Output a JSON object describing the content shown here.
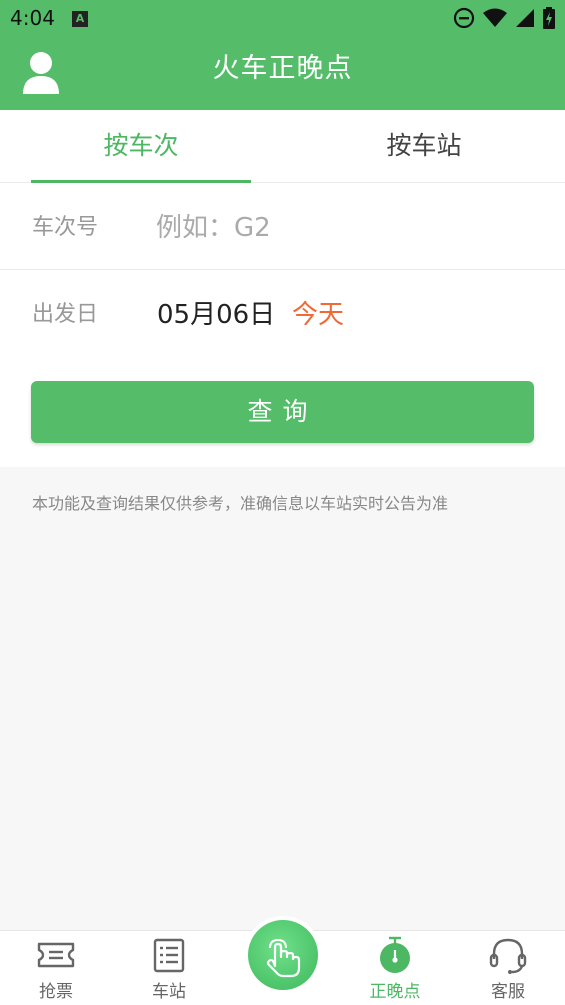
{
  "status_bar": {
    "time": "4:04",
    "notification_icon": "A"
  },
  "header": {
    "title": "火车正晚点",
    "avatar_icon": "user-icon"
  },
  "tabs": [
    {
      "label": "按车次",
      "active": true
    },
    {
      "label": "按车站",
      "active": false
    }
  ],
  "form": {
    "train_label": "车次号",
    "train_placeholder": "例如：G2",
    "date_label": "出发日",
    "date_value": "05月06日",
    "date_hint": "今天",
    "query_label": "查询"
  },
  "notice": "本功能及查询结果仅供参考，准确信息以车站实时公告为准",
  "bottom_nav": [
    {
      "label": "抢票",
      "icon": "ticket-icon"
    },
    {
      "label": "车站",
      "icon": "list-icon"
    },
    {
      "label": "",
      "icon": "tap-hand-icon"
    },
    {
      "label": "正晚点",
      "icon": "timer-icon",
      "active": true
    },
    {
      "label": "客服",
      "icon": "headset-icon"
    }
  ],
  "colors": {
    "primary": "#55bd6a",
    "accent": "#f06a35"
  }
}
